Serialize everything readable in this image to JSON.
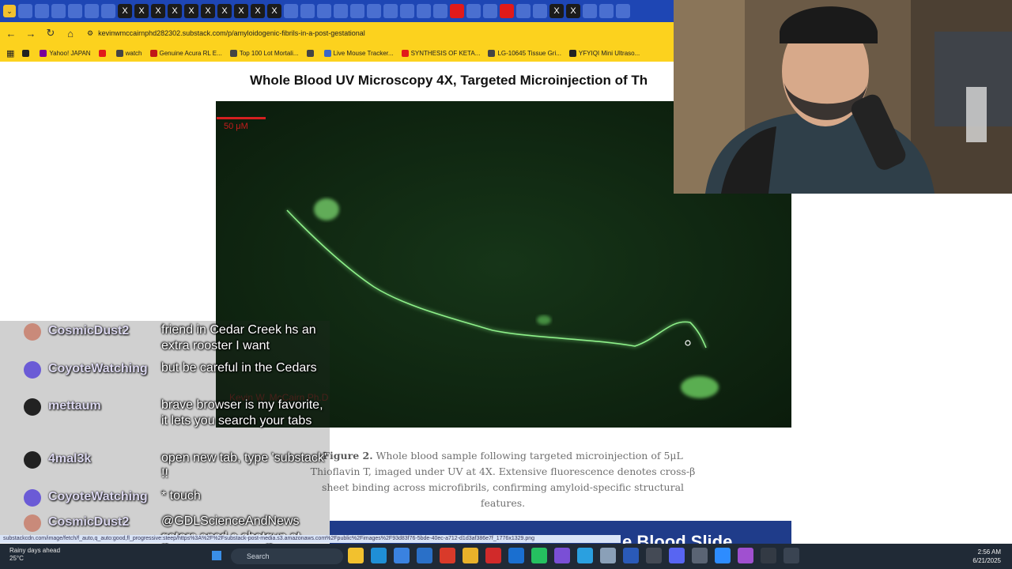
{
  "browser": {
    "url": "kevinwmccairnphd282302.substack.com/p/amyloidogenic-fibrils-in-a-post-gestational",
    "bookmarks": [
      {
        "label": "",
        "color": "#222222"
      },
      {
        "label": "Yahoo! JAPAN",
        "color": "#7b0099"
      },
      {
        "label": "",
        "color": "#e11a1a"
      },
      {
        "label": "watch",
        "color": "#444444"
      },
      {
        "label": "Genuine Acura RL E...",
        "color": "#c01818"
      },
      {
        "label": "Top 100 Lot Mortali...",
        "color": "#444444"
      },
      {
        "label": "",
        "color": "#444444"
      },
      {
        "label": "Live Mouse Tracker...",
        "color": "#3a66c8"
      },
      {
        "label": "SYNTHESIS OF KETA...",
        "color": "#e11a1a"
      },
      {
        "label": "LG-10645 Tissue Gri...",
        "color": "#444444"
      },
      {
        "label": "YFYIQI Mini Ultraso...",
        "color": "#222222"
      }
    ]
  },
  "article": {
    "title": "Whole Blood UV Microscopy 4X, Targeted Microinjection of Th",
    "scale_label": "50 μM",
    "watermark": "Kevin W. McCairn Ph.D",
    "caption_label": "Figure 2.",
    "caption_text": " Whole blood sample following targeted microinjection of 5μL Thioflavin T, imaged under UV at 4X. Extensive fluorescence denotes cross-β sheet binding across microfibrils, confirming amyloid-specific structural features.",
    "next_heading": "e Blood Slide"
  },
  "chat": [
    {
      "user": "CosmicDust2",
      "message": "friend in Cedar Creek hs an extra rooster I want",
      "avatar_color": "#c98a7a"
    },
    {
      "user": "CoyoteWatching",
      "message": "but be careful in the Cedars",
      "avatar_color": "#6b5bd6"
    },
    {
      "user": "mettaum",
      "message": "brave browser is my favorite, it lets you search your tabs",
      "avatar_color": "#222222"
    },
    {
      "user": "4mal3k",
      "message": "open new tab, type 'substack' !!",
      "avatar_color": "#222222"
    },
    {
      "user": "CoyoteWatching",
      "message": "* touch",
      "avatar_color": "#6b5bd6"
    },
    {
      "user": "CosmicDust2",
      "message": "@GDLScienceAndNews gators ansd a shotgun at front door",
      "avatar_color": "#c98a7a"
    }
  ],
  "status_link": "substackcdn.com/image/fetch/f_auto,q_auto:good,fl_progressive:steep/https%3A%2F%2Fsubstack-post-media.s3.amazonaws.com%2Fpublic%2Fimages%2F93d83f76-5bde-40ec-a712-d1d3af386e7f_1776x1329.png",
  "taskbar": {
    "weather_title": "Rainy days ahead",
    "weather_temp": "25°C",
    "search_placeholder": "Search",
    "time": "2:56 AM",
    "date": "6/21/2025",
    "icons": [
      {
        "name": "file-explorer-icon",
        "color": "#f2c12e"
      },
      {
        "name": "edge-icon",
        "color": "#1f8fd6"
      },
      {
        "name": "store-icon",
        "color": "#3a82e0"
      },
      {
        "name": "app-icon",
        "color": "#2a70c8"
      },
      {
        "name": "red-app-icon",
        "color": "#d93a2a"
      },
      {
        "name": "chrome-icon",
        "color": "#e8b12a"
      },
      {
        "name": "acrobat-icon",
        "color": "#d12a2a"
      },
      {
        "name": "outlook-icon",
        "color": "#1a6fd0"
      },
      {
        "name": "whatsapp-icon",
        "color": "#25c060"
      },
      {
        "name": "viber-icon",
        "color": "#7a4fd6"
      },
      {
        "name": "telegram-icon",
        "color": "#2aa0e0"
      },
      {
        "name": "photos-icon",
        "color": "#8aa0b8"
      },
      {
        "name": "word-icon",
        "color": "#2a5ab8"
      },
      {
        "name": "4k-icon",
        "color": "#444a55"
      },
      {
        "name": "discord-icon",
        "color": "#5865f2"
      },
      {
        "name": "settings-icon",
        "color": "#5a6474"
      },
      {
        "name": "zoom-icon",
        "color": "#2d8cff"
      },
      {
        "name": "app-purple-icon",
        "color": "#a050d0"
      },
      {
        "name": "terminal-icon",
        "color": "#333a44"
      },
      {
        "name": "window-icon",
        "color": "#3a4452"
      }
    ]
  }
}
